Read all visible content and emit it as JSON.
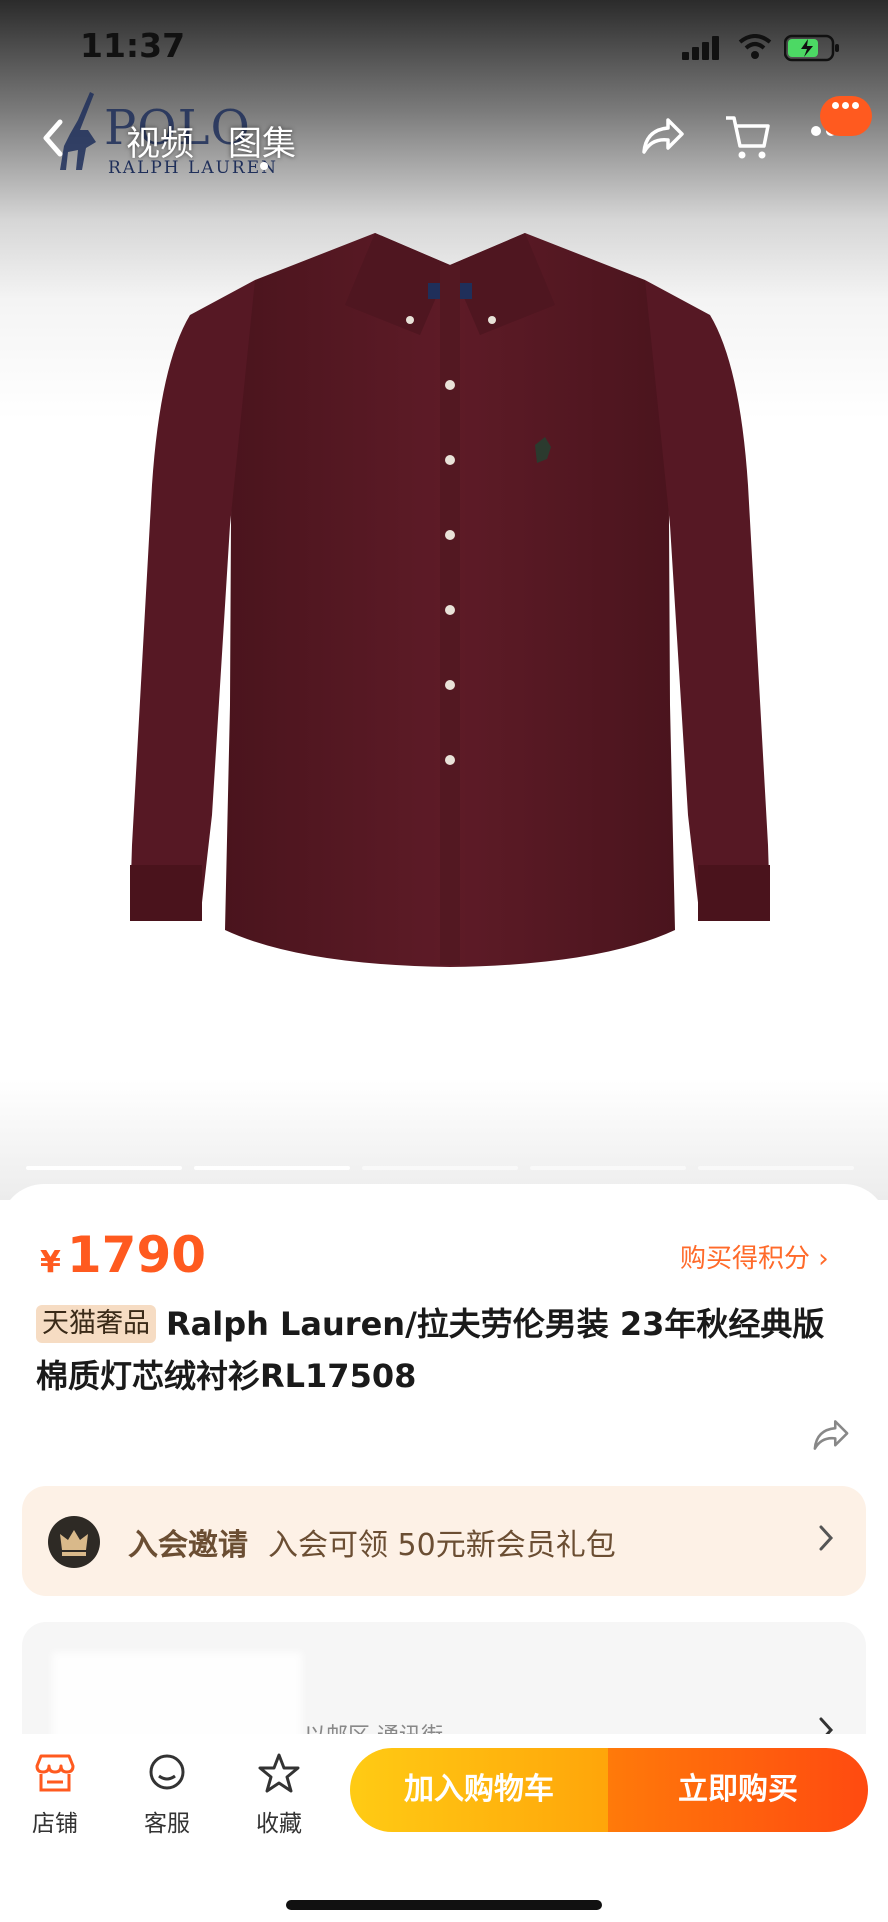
{
  "status_bar": {
    "time": "11:37"
  },
  "header": {
    "brand_text": "POLO",
    "brand_sub": "RALPH LAUREN",
    "tabs": [
      {
        "label": "视频"
      },
      {
        "label": "图集"
      }
    ],
    "icons": [
      "back-icon",
      "share-icon",
      "cart-icon",
      "more-icon"
    ]
  },
  "gallery": {
    "slides": 5,
    "current": 2,
    "shirt_color": "#5a1a24"
  },
  "product": {
    "currency": "¥",
    "price": "1790",
    "points_link": "购买得积分 ›",
    "badge": "天猫奢品",
    "title": "Ralph Lauren/拉夫劳伦男装 23年秋经典版棉质灯芯绒衬衫RL17508"
  },
  "promo": {
    "label": "入会邀请",
    "description": "入会可领 50元新会员礼包"
  },
  "info_row": {
    "text": "…以邮区 通讯街…"
  },
  "bottom_bar": {
    "shop_label": "店铺",
    "service_label": "客服",
    "fav_label": "收藏",
    "add_to_cart": "加入购物车",
    "buy_now": "立即购买"
  },
  "colors": {
    "accent": "#ff5a1f",
    "cart_button": "#ffb30f",
    "buy_button": "#ff5a10",
    "promo_bg": "#fdf1e6"
  }
}
